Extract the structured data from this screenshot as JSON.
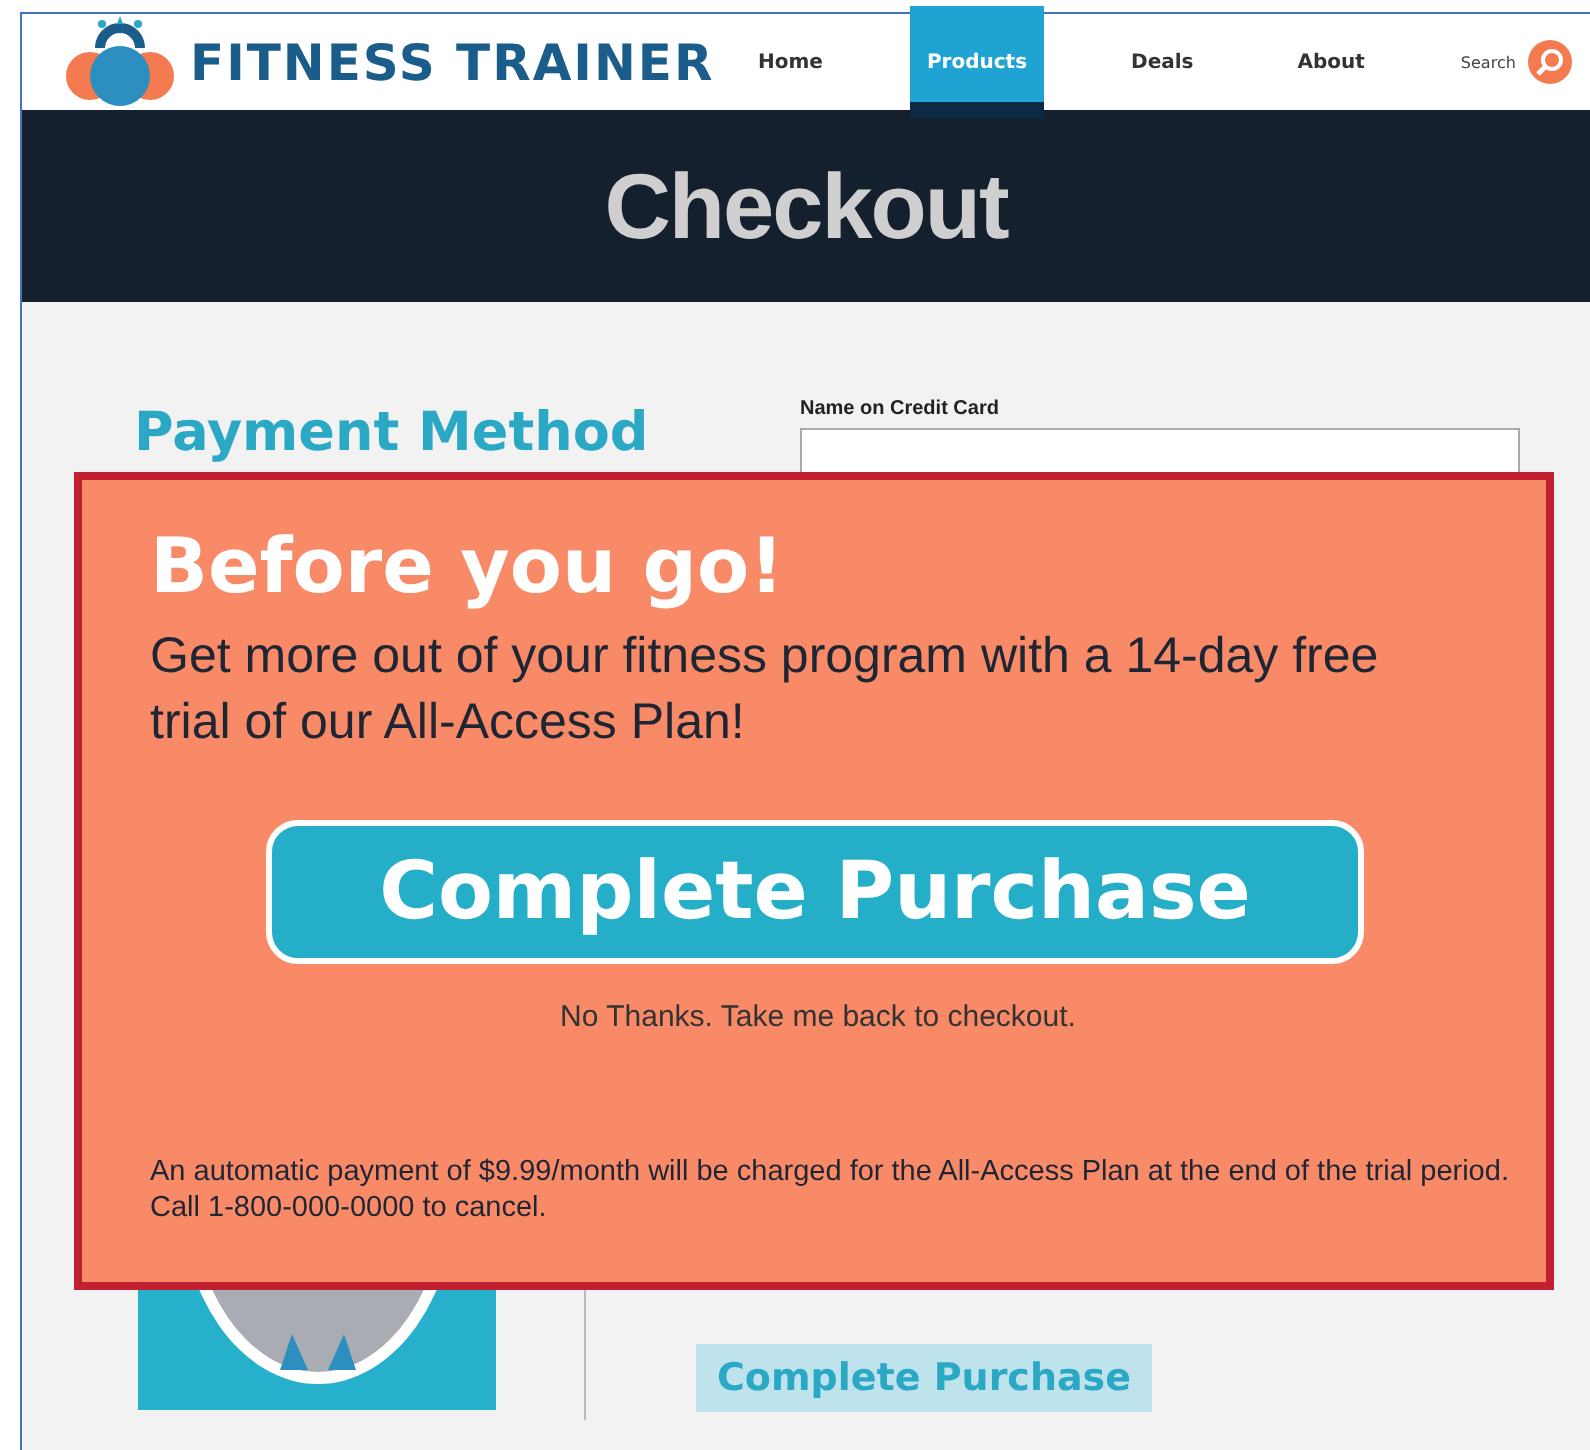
{
  "header": {
    "logo": {
      "text": "FITNESS TRAINER"
    },
    "nav": [
      {
        "label": "Home",
        "selected": false
      },
      {
        "label": "Products",
        "selected": true
      },
      {
        "label": "Deals",
        "selected": false
      },
      {
        "label": "About",
        "selected": false
      }
    ],
    "search": {
      "label": "Search"
    }
  },
  "banner": {
    "title": "Checkout"
  },
  "payment": {
    "heading": "Payment Method",
    "fields": [
      {
        "label": "Name on Credit Card"
      }
    ]
  },
  "order": {
    "button": "Complete Purchase"
  },
  "modal": {
    "title": "Before you go!",
    "message": "Get more out of your fitness program with a 14-day free trial of our All-Access Plan!",
    "button": "Complete Purchase",
    "decline_link": "No Thanks. Take me back to checkout.",
    "disclaimer": "An automatic payment of $9.99/month will be charged for the All-Access Plan at the end of the trial period. Call 1-800-000-0000 to cancel."
  }
}
